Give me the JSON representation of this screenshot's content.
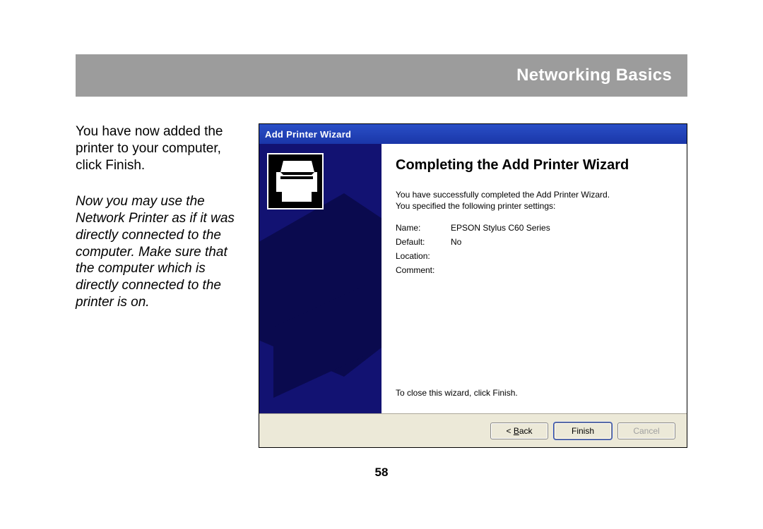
{
  "header": {
    "title": "Networking Basics"
  },
  "left": {
    "para1": "You have now added the printer to your computer, click Finish.",
    "para2": "Now you may use the Network Printer as if it was directly connected to the computer.  Make sure that the computer which is directly connected to the printer is on."
  },
  "wizard": {
    "titlebar": "Add Printer Wizard",
    "heading": "Completing the Add Printer Wizard",
    "desc_line1": "You have successfully completed the Add Printer Wizard.",
    "desc_line2": "You specified the following printer settings:",
    "settings": {
      "name_label": "Name:",
      "name_value": "EPSON Stylus C60 Series",
      "default_label": "Default:",
      "default_value": "No",
      "location_label": "Location:",
      "location_value": "",
      "comment_label": "Comment:",
      "comment_value": ""
    },
    "close_hint": "To close this wizard, click Finish.",
    "buttons": {
      "back_prefix": "< ",
      "back_u": "B",
      "back_rest": "ack",
      "finish": "Finish",
      "cancel": "Cancel"
    }
  },
  "page_number": "58"
}
